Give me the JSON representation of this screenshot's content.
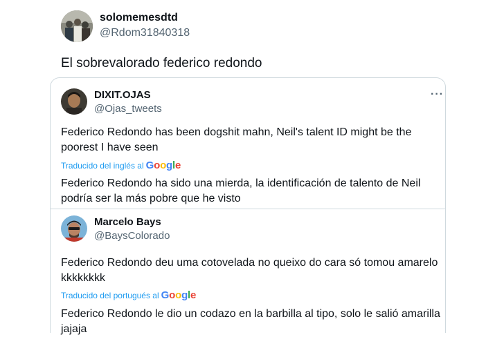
{
  "main_tweet": {
    "name": "solomemesdtd",
    "handle": "@Rdom31840318",
    "text": "El sobrevalorado federico redondo"
  },
  "quoted_tweets": [
    {
      "name": "DIXIT.OJAS",
      "handle": "@Ojas_tweets",
      "text": "Federico Redondo has been dogshit mahn, Neil's talent ID might be the poorest I have seen",
      "translated_label": "Traducido del inglés al",
      "translated_text": "Federico Redondo ha sido una mierda, la identificación de talento de Neil podría ser la más pobre que he visto",
      "more_icon": "more-icon"
    },
    {
      "name": "Marcelo Bays",
      "handle": "@BaysColorado",
      "text": "Federico Redondo deu uma cotovelada no queixo do cara só tomou amarelo kkkkkkkk",
      "translated_label": "Traducido del portugués al",
      "translated_text": "Federico Redondo le dio un codazo en la barbilla al tipo, solo le salió amarilla jajaja"
    }
  ],
  "google_letters": [
    {
      "char": "G",
      "color": "#4285F4"
    },
    {
      "char": "o",
      "color": "#EA4335"
    },
    {
      "char": "o",
      "color": "#FBBC05"
    },
    {
      "char": "g",
      "color": "#4285F4"
    },
    {
      "char": "l",
      "color": "#34A853"
    },
    {
      "char": "e",
      "color": "#EA4335"
    }
  ],
  "colors": {
    "link_blue": "#1d9bf0",
    "secondary_text": "#536471",
    "border": "#cfd9de"
  }
}
